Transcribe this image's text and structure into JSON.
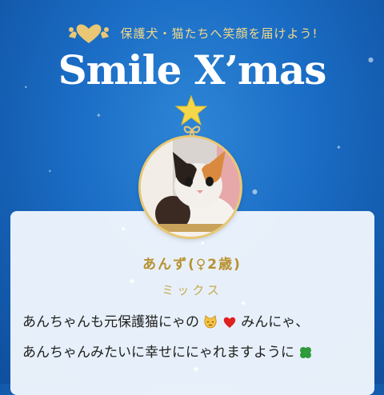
{
  "header": {
    "tagline": "保護犬・猫たちへ笑顔を届けよう!",
    "title": "Smile X’mas"
  },
  "pet": {
    "name": "あんず(♀2歳)",
    "breed": "ミックス"
  },
  "message": {
    "line1_a": "あんちゃんも元保護猫にゃの",
    "line1_b": " みんにゃ、",
    "line2_a": "あんちゃんみたいに幸せににゃれますように"
  },
  "colors": {
    "background": "#1a6cc4",
    "gold": "#e9c774",
    "star": "#f5d84a",
    "card": "#eef5fc"
  },
  "icons": [
    "logo-icon",
    "star-icon",
    "bow-icon",
    "cat-face-icon",
    "heart-icon",
    "clover-icon"
  ]
}
